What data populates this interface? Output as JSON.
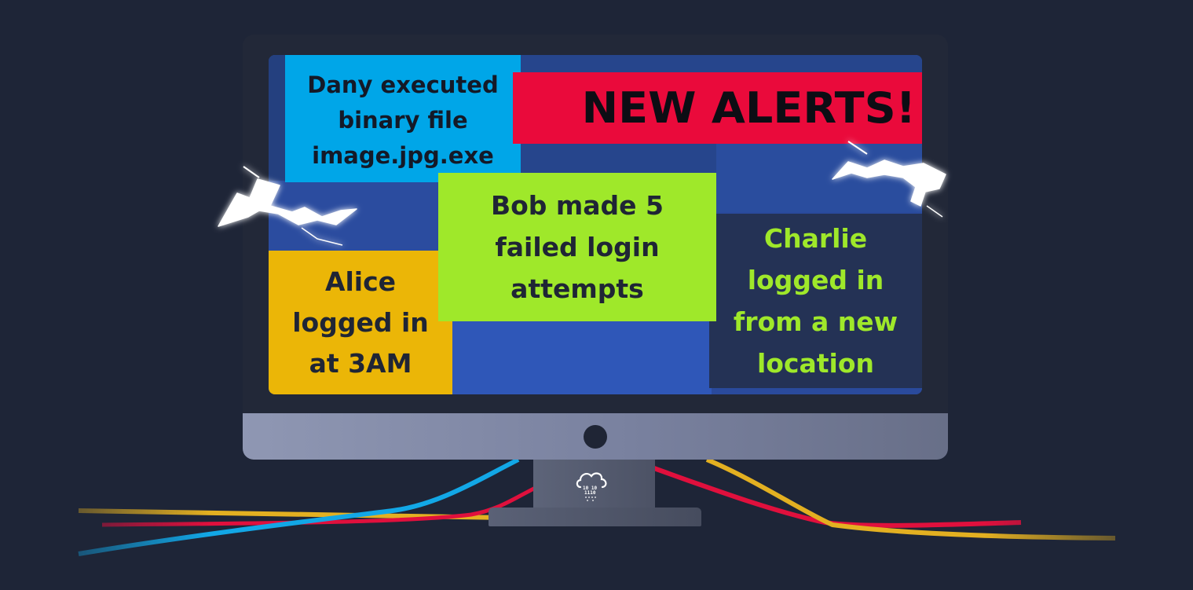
{
  "alerts": {
    "header": "NEW ALERTS!",
    "dany": {
      "line1": "Dany executed",
      "line2": "binary file",
      "line3": "image.jpg.exe"
    },
    "bob": {
      "line1": "Bob made 5",
      "line2": "failed login",
      "line3": "attempts"
    },
    "alice": {
      "line1": "Alice",
      "line2": "logged in",
      "line3": "at 3AM"
    },
    "charlie": {
      "line1": "Charlie",
      "line2": "logged in",
      "line3": "from a new",
      "line4": "location"
    }
  },
  "logo": {
    "binary_line1": "10 10",
    "binary_line2": "1110"
  },
  "colors": {
    "background": "#1e2537",
    "alert_red": "#ea0a3b",
    "alert_green": "#9fe82a",
    "alert_blue": "#00a6e8",
    "alert_yellow": "#ebb607",
    "alert_navy": "#243255"
  },
  "icons": {
    "logo": "cloud-binary-icon",
    "sparks": "lightning-spark-icon"
  }
}
